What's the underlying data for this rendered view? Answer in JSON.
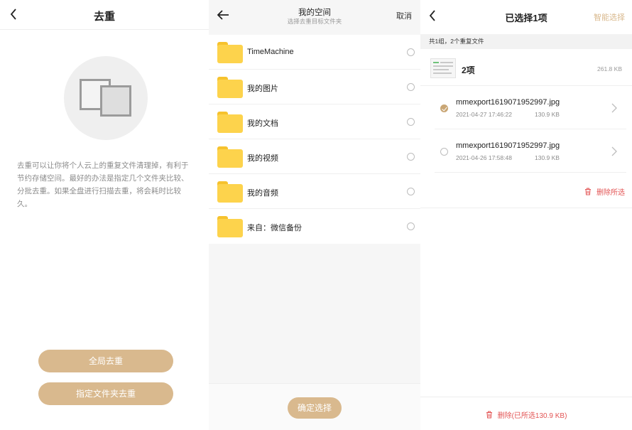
{
  "panel1": {
    "title": "去重",
    "description": "去重可以让你将个人云上的重复文件清理掉，有利于节约存储空间。最好的办法是指定几个文件夹比较、分批去重。如果全盘进行扫描去重，将会耗时比较久。",
    "btn_global": "全局去重",
    "btn_folder": "指定文件夹去重",
    "accent_color": "#d9b98e"
  },
  "panel2": {
    "title": "我的空间",
    "subtitle": "选择去重目标文件夹",
    "cancel": "取消",
    "folders": [
      {
        "name": "TimeMachine"
      },
      {
        "name": "我的图片"
      },
      {
        "name": "我的文档"
      },
      {
        "name": "我的视频"
      },
      {
        "name": "我的音频"
      },
      {
        "name": "来自：微信备份"
      }
    ],
    "confirm": "确定选择",
    "folder_color": "#fdd34c"
  },
  "panel3": {
    "title": "已选择1项",
    "smart_select": "智能选择",
    "group_summary": "共1组，2个重复文件",
    "group": {
      "count_label": "2项",
      "size": "261.8 KB"
    },
    "files": [
      {
        "name": "mmexport1619071952997.jpg",
        "date": "2021-04-27 17:46:22",
        "size": "130.9 KB",
        "checked": true
      },
      {
        "name": "mmexport1619071952997.jpg",
        "date": "2021-04-26 17:58:48",
        "size": "130.9 KB",
        "checked": false
      }
    ],
    "delete_selected": "删除所选",
    "bottom_delete": "删除(已所选130.9 KB)",
    "danger_color": "#e35555"
  }
}
